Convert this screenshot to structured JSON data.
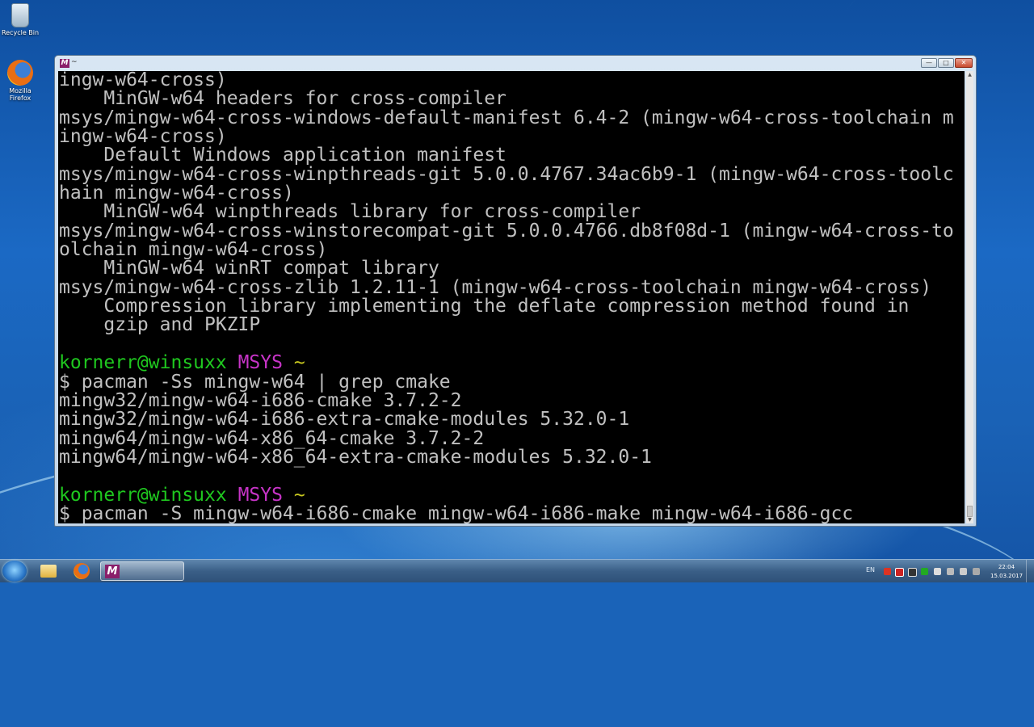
{
  "desktop": {
    "icons": [
      {
        "label": "Recycle Bin",
        "icon": "recycle-bin-icon"
      },
      {
        "label": "Mozilla Firefox",
        "icon": "firefox-icon"
      }
    ]
  },
  "window": {
    "title": "~",
    "app_icon": "msys-icon",
    "buttons": {
      "minimize": "—",
      "maximize": "□",
      "close": "✕"
    }
  },
  "terminal": {
    "lines": [
      "ingw-w64-cross)",
      "    MinGW-w64 headers for cross-compiler",
      "msys/mingw-w64-cross-windows-default-manifest 6.4-2 (mingw-w64-cross-toolchain m",
      "ingw-w64-cross)",
      "    Default Windows application manifest",
      "msys/mingw-w64-cross-winpthreads-git 5.0.0.4767.34ac6b9-1 (mingw-w64-cross-toolc",
      "hain mingw-w64-cross)",
      "    MinGW-w64 winpthreads library for cross-compiler",
      "msys/mingw-w64-cross-winstorecompat-git 5.0.0.4766.db8f08d-1 (mingw-w64-cross-to",
      "olchain mingw-w64-cross)",
      "    MinGW-w64 winRT compat library",
      "msys/mingw-w64-cross-zlib 1.2.11-1 (mingw-w64-cross-toolchain mingw-w64-cross)",
      "    Compression library implementing the deflate compression method found in",
      "    gzip and PKZIP",
      ""
    ],
    "prompt1": {
      "user": "kornerr@winsuxx",
      "env": "MSYS",
      "path": "~"
    },
    "command1": "$ pacman -Ss mingw-w64 | grep cmake",
    "results": [
      "mingw32/mingw-w64-i686-cmake 3.7.2-2",
      "mingw32/mingw-w64-i686-extra-cmake-modules 5.32.0-1",
      "mingw64/mingw-w64-x86_64-cmake 3.7.2-2",
      "mingw64/mingw-w64-x86_64-extra-cmake-modules 5.32.0-1"
    ],
    "prompt2": {
      "user": "kornerr@winsuxx",
      "env": "MSYS",
      "path": "~"
    },
    "command2": "$ pacman -S mingw-w64-i686-cmake mingw-w64-i686-make mingw-w64-i686-gcc",
    "colors": {
      "user": "#1fc81f",
      "env": "#c834c8",
      "path": "#c8c81f",
      "text": "#c0c0c0"
    }
  },
  "taskbar": {
    "pinned": [
      "windows-explorer-icon",
      "firefox-icon",
      "msys-icon"
    ],
    "language": "EN",
    "clock": {
      "time": "22:04",
      "date": "15.03.2017"
    }
  }
}
